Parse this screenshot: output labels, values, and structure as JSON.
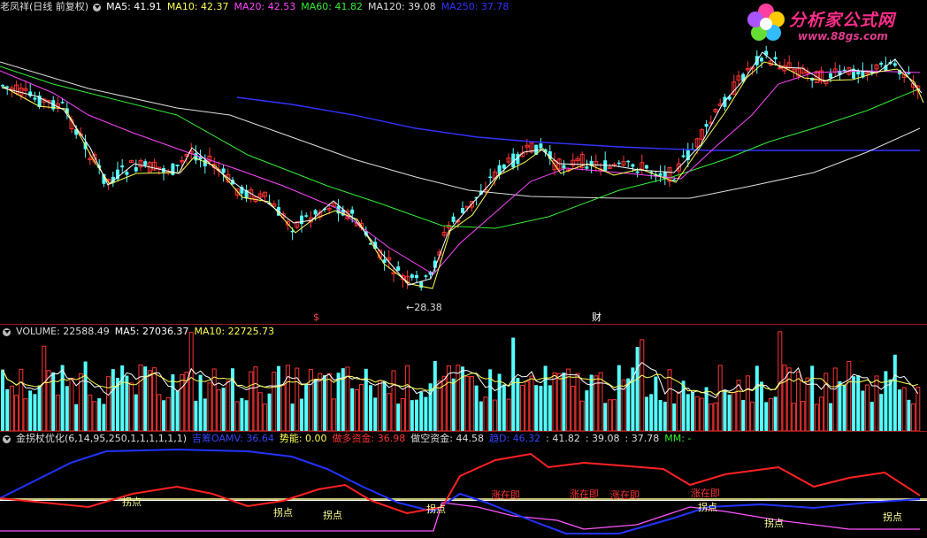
{
  "logo": {
    "brand": "分析家公式网",
    "url": "www.88gs.com"
  },
  "price_pane": {
    "title": "老凤祥(日线 前复权)",
    "indicators": [
      {
        "label": "MA5: 41.91",
        "color": "#ffffff"
      },
      {
        "label": "MA10: 42.37",
        "color": "#ffff55"
      },
      {
        "label": "MA20: 42.53",
        "color": "#ff44ff"
      },
      {
        "label": "MA60: 41.82",
        "color": "#33ee33"
      },
      {
        "label": "MA120: 39.08",
        "color": "#dddddd"
      },
      {
        "label": "MA250: 37.78",
        "color": "#3333ff"
      }
    ],
    "low_label": "←28.38",
    "markers": [
      {
        "text": "$",
        "color": "#ff4444"
      },
      {
        "text": "财",
        "color": "#ffffff"
      }
    ]
  },
  "volume_pane": {
    "title": "VOLUME: 22588.49",
    "indicators": [
      {
        "label": "MA5: 27036.37",
        "color": "#ffffff"
      },
      {
        "label": "MA10: 22725.73",
        "color": "#ffff55"
      }
    ]
  },
  "indicator_pane": {
    "title": "金拐杖优化(6,14,95,250,1,1,1,1,1,1)",
    "indicators": [
      {
        "label": "吉筹OAMV: 36.64",
        "color": "#3344ff"
      },
      {
        "label": "势能: 0.00",
        "color": "#ffff55"
      },
      {
        "label": "做多资金: 36.98",
        "color": "#ff3333"
      },
      {
        "label": "做空资金: 44.58",
        "color": "#dddddd"
      },
      {
        "label": "趋D: 46.32",
        "color": "#3344ff"
      },
      {
        "label": ": 41.82",
        "color": "#dddddd"
      },
      {
        "label": ": 39.08",
        "color": "#dddddd"
      },
      {
        "label": ": 37.78",
        "color": "#dddddd"
      },
      {
        "label": "MM: -",
        "color": "#33ee33"
      }
    ],
    "annotations": [
      {
        "text": "拐点",
        "color": "#ffff99"
      },
      {
        "text": "拐点",
        "color": "#ffff99"
      },
      {
        "text": "拐点",
        "color": "#ffff99"
      },
      {
        "text": "拐点",
        "color": "#ffff99"
      },
      {
        "text": "涨在即",
        "color": "#ff3333"
      },
      {
        "text": "涨在即",
        "color": "#ff3333"
      },
      {
        "text": "涨在即",
        "color": "#ff3333"
      },
      {
        "text": "涨在即",
        "color": "#ff3333"
      },
      {
        "text": "拐点",
        "color": "#ffff99"
      },
      {
        "text": "拐点",
        "color": "#ffff99"
      },
      {
        "text": "拐点",
        "color": "#ffff99"
      }
    ]
  }
}
